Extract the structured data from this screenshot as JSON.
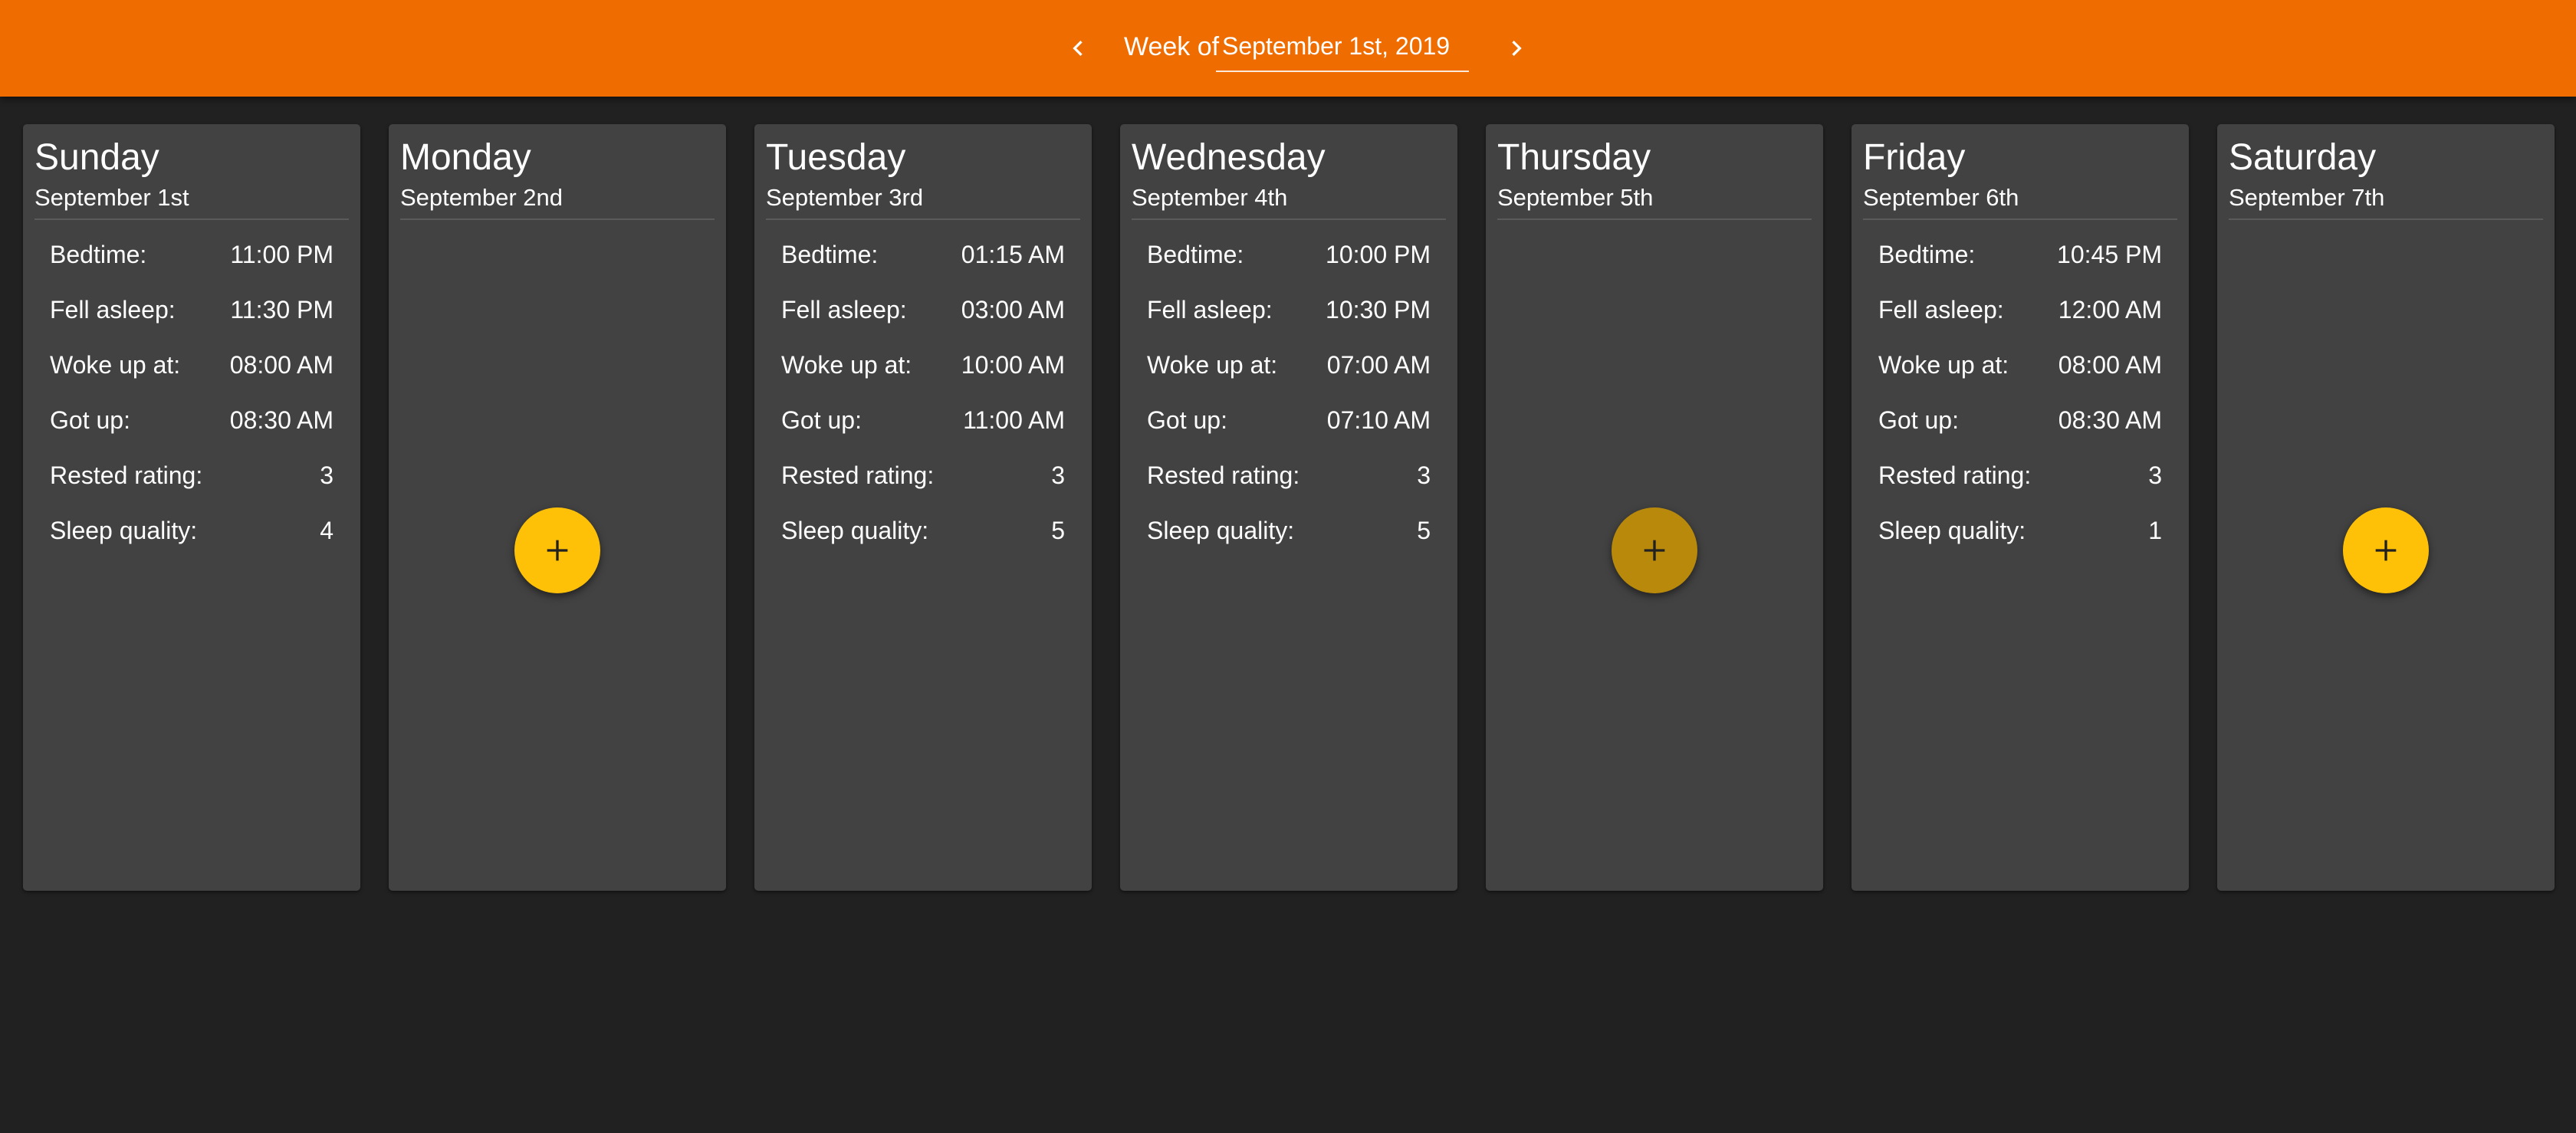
{
  "header": {
    "week_prefix": "Week of",
    "week_value": "September 1st, 2019",
    "prev_icon": "chevron-left-icon",
    "next_icon": "chevron-right-icon",
    "bar_color": "#ef6c00"
  },
  "labels": {
    "bedtime": "Bedtime:",
    "fell_asleep": "Fell asleep:",
    "woke_up": "Woke up at:",
    "got_up": "Got up:",
    "rested": "Rested rating:",
    "quality": "Sleep quality:"
  },
  "add_icon": "plus-icon",
  "colors": {
    "background": "#212121",
    "card": "#424242",
    "fab": "#ffc107",
    "fab_hover": "#b8890b"
  },
  "days": [
    {
      "name": "Sunday",
      "date": "September 1st",
      "has_entry": true,
      "bedtime": "11:00 PM",
      "fell_asleep": "11:30 PM",
      "woke_up": "08:00 AM",
      "got_up": "08:30 AM",
      "rested": "3",
      "quality": "4"
    },
    {
      "name": "Monday",
      "date": "September 2nd",
      "has_entry": false
    },
    {
      "name": "Tuesday",
      "date": "September 3rd",
      "has_entry": true,
      "bedtime": "01:15 AM",
      "fell_asleep": "03:00 AM",
      "woke_up": "10:00 AM",
      "got_up": "11:00 AM",
      "rested": "3",
      "quality": "5"
    },
    {
      "name": "Wednesday",
      "date": "September 4th",
      "has_entry": true,
      "bedtime": "10:00 PM",
      "fell_asleep": "10:30 PM",
      "woke_up": "07:00 AM",
      "got_up": "07:10 AM",
      "rested": "3",
      "quality": "5"
    },
    {
      "name": "Thursday",
      "date": "September 5th",
      "has_entry": false,
      "hovered": true
    },
    {
      "name": "Friday",
      "date": "September 6th",
      "has_entry": true,
      "bedtime": "10:45 PM",
      "fell_asleep": "12:00 AM",
      "woke_up": "08:00 AM",
      "got_up": "08:30 AM",
      "rested": "3",
      "quality": "1"
    },
    {
      "name": "Saturday",
      "date": "September 7th",
      "has_entry": false
    }
  ]
}
